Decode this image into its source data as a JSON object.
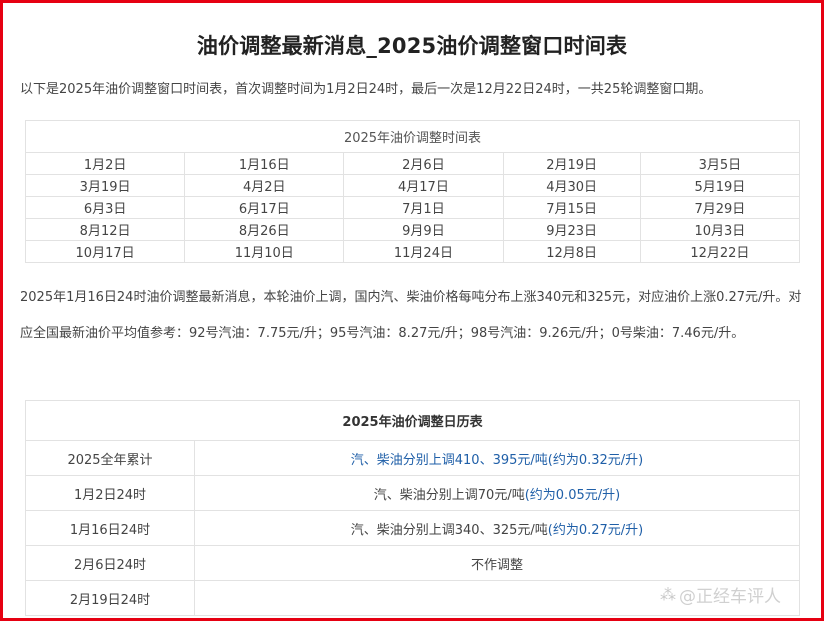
{
  "article": {
    "title": "油价调整最新消息_2025油价调整窗口时间表",
    "intro": "以下是2025年油价调整窗口时间表，首次调整时间为1月2日24时，最后一次是12月22日24时，一共25轮调整窗口期。",
    "schedule_table": {
      "caption": "2025年油价调整时间表",
      "rows": [
        [
          "1月2日",
          "1月16日",
          "2月6日",
          "2月19日",
          "3月5日"
        ],
        [
          "3月19日",
          "4月2日",
          "4月17日",
          "4月30日",
          "5月19日"
        ],
        [
          "6月3日",
          "6月17日",
          "7月1日",
          "7月15日",
          "7月29日"
        ],
        [
          "8月12日",
          "8月26日",
          "9月9日",
          "9月23日",
          "10月3日"
        ],
        [
          "10月17日",
          "11月10日",
          "11月24日",
          "12月8日",
          "12月22日"
        ]
      ]
    },
    "paragraph": "2025年1月16日24时油价调整最新消息，本轮油价上调，国内汽、柴油价格每吨分布上涨340元和325元，对应油价上涨0.27元/升。对应全国最新油价平均值参考：92号汽油：7.75元/升；95号汽油：8.27元/升；98号汽油：9.26元/升；0号柴油：7.46元/升。",
    "calendar_table": {
      "caption": "2025年油价调整日历表",
      "rows": [
        {
          "date": "2025全年累计",
          "main": "汽、柴油分别上调410、395元/吨",
          "note": "(约为0.32元/升)",
          "blue_main": true
        },
        {
          "date": "1月2日24时",
          "main": "汽、柴油分别上调70元/吨",
          "note": "(约为0.05元/升)",
          "blue_main": false
        },
        {
          "date": "1月16日24时",
          "main": "汽、柴油分别上调340、325元/吨",
          "note": "(约为0.27元/升)",
          "blue_main": false
        },
        {
          "date": "2月6日24时",
          "main": "不作调整",
          "note": "",
          "blue_main": false
        },
        {
          "date": "2月19日24时",
          "main": "",
          "note": "",
          "blue_main": false
        }
      ]
    }
  },
  "watermark": {
    "text": "@正经车评人",
    "icon": "toutiao-logo-icon"
  },
  "colors": {
    "frame": "#e60012",
    "link_blue": "#1f5fa8",
    "border": "#e2e2e2"
  }
}
